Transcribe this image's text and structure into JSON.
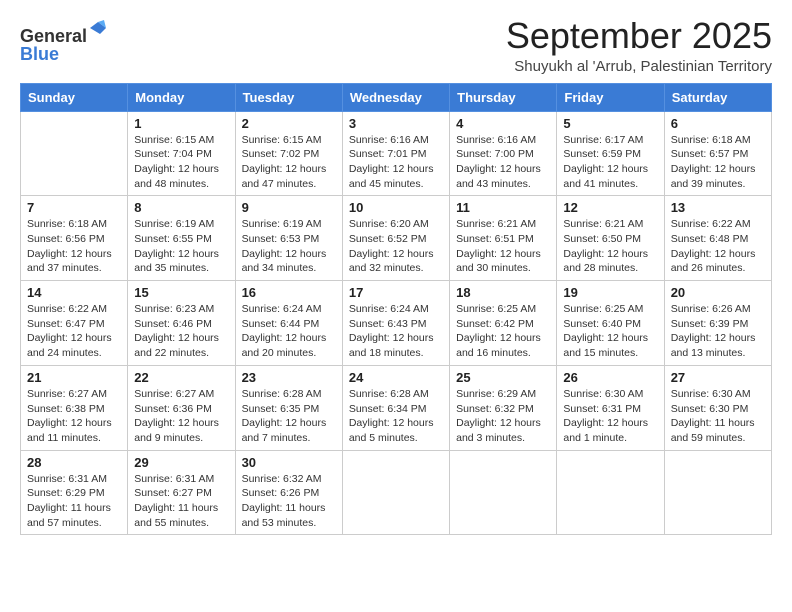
{
  "logo": {
    "general": "General",
    "blue": "Blue"
  },
  "title": "September 2025",
  "subtitle": "Shuyukh al 'Arrub, Palestinian Territory",
  "days_of_week": [
    "Sunday",
    "Monday",
    "Tuesday",
    "Wednesday",
    "Thursday",
    "Friday",
    "Saturday"
  ],
  "weeks": [
    [
      {
        "day": "",
        "info": ""
      },
      {
        "day": "1",
        "info": "Sunrise: 6:15 AM\nSunset: 7:04 PM\nDaylight: 12 hours and 48 minutes."
      },
      {
        "day": "2",
        "info": "Sunrise: 6:15 AM\nSunset: 7:02 PM\nDaylight: 12 hours and 47 minutes."
      },
      {
        "day": "3",
        "info": "Sunrise: 6:16 AM\nSunset: 7:01 PM\nDaylight: 12 hours and 45 minutes."
      },
      {
        "day": "4",
        "info": "Sunrise: 6:16 AM\nSunset: 7:00 PM\nDaylight: 12 hours and 43 minutes."
      },
      {
        "day": "5",
        "info": "Sunrise: 6:17 AM\nSunset: 6:59 PM\nDaylight: 12 hours and 41 minutes."
      },
      {
        "day": "6",
        "info": "Sunrise: 6:18 AM\nSunset: 6:57 PM\nDaylight: 12 hours and 39 minutes."
      }
    ],
    [
      {
        "day": "7",
        "info": "Sunrise: 6:18 AM\nSunset: 6:56 PM\nDaylight: 12 hours and 37 minutes."
      },
      {
        "day": "8",
        "info": "Sunrise: 6:19 AM\nSunset: 6:55 PM\nDaylight: 12 hours and 35 minutes."
      },
      {
        "day": "9",
        "info": "Sunrise: 6:19 AM\nSunset: 6:53 PM\nDaylight: 12 hours and 34 minutes."
      },
      {
        "day": "10",
        "info": "Sunrise: 6:20 AM\nSunset: 6:52 PM\nDaylight: 12 hours and 32 minutes."
      },
      {
        "day": "11",
        "info": "Sunrise: 6:21 AM\nSunset: 6:51 PM\nDaylight: 12 hours and 30 minutes."
      },
      {
        "day": "12",
        "info": "Sunrise: 6:21 AM\nSunset: 6:50 PM\nDaylight: 12 hours and 28 minutes."
      },
      {
        "day": "13",
        "info": "Sunrise: 6:22 AM\nSunset: 6:48 PM\nDaylight: 12 hours and 26 minutes."
      }
    ],
    [
      {
        "day": "14",
        "info": "Sunrise: 6:22 AM\nSunset: 6:47 PM\nDaylight: 12 hours and 24 minutes."
      },
      {
        "day": "15",
        "info": "Sunrise: 6:23 AM\nSunset: 6:46 PM\nDaylight: 12 hours and 22 minutes."
      },
      {
        "day": "16",
        "info": "Sunrise: 6:24 AM\nSunset: 6:44 PM\nDaylight: 12 hours and 20 minutes."
      },
      {
        "day": "17",
        "info": "Sunrise: 6:24 AM\nSunset: 6:43 PM\nDaylight: 12 hours and 18 minutes."
      },
      {
        "day": "18",
        "info": "Sunrise: 6:25 AM\nSunset: 6:42 PM\nDaylight: 12 hours and 16 minutes."
      },
      {
        "day": "19",
        "info": "Sunrise: 6:25 AM\nSunset: 6:40 PM\nDaylight: 12 hours and 15 minutes."
      },
      {
        "day": "20",
        "info": "Sunrise: 6:26 AM\nSunset: 6:39 PM\nDaylight: 12 hours and 13 minutes."
      }
    ],
    [
      {
        "day": "21",
        "info": "Sunrise: 6:27 AM\nSunset: 6:38 PM\nDaylight: 12 hours and 11 minutes."
      },
      {
        "day": "22",
        "info": "Sunrise: 6:27 AM\nSunset: 6:36 PM\nDaylight: 12 hours and 9 minutes."
      },
      {
        "day": "23",
        "info": "Sunrise: 6:28 AM\nSunset: 6:35 PM\nDaylight: 12 hours and 7 minutes."
      },
      {
        "day": "24",
        "info": "Sunrise: 6:28 AM\nSunset: 6:34 PM\nDaylight: 12 hours and 5 minutes."
      },
      {
        "day": "25",
        "info": "Sunrise: 6:29 AM\nSunset: 6:32 PM\nDaylight: 12 hours and 3 minutes."
      },
      {
        "day": "26",
        "info": "Sunrise: 6:30 AM\nSunset: 6:31 PM\nDaylight: 12 hours and 1 minute."
      },
      {
        "day": "27",
        "info": "Sunrise: 6:30 AM\nSunset: 6:30 PM\nDaylight: 11 hours and 59 minutes."
      }
    ],
    [
      {
        "day": "28",
        "info": "Sunrise: 6:31 AM\nSunset: 6:29 PM\nDaylight: 11 hours and 57 minutes."
      },
      {
        "day": "29",
        "info": "Sunrise: 6:31 AM\nSunset: 6:27 PM\nDaylight: 11 hours and 55 minutes."
      },
      {
        "day": "30",
        "info": "Sunrise: 6:32 AM\nSunset: 6:26 PM\nDaylight: 11 hours and 53 minutes."
      },
      {
        "day": "",
        "info": ""
      },
      {
        "day": "",
        "info": ""
      },
      {
        "day": "",
        "info": ""
      },
      {
        "day": "",
        "info": ""
      }
    ]
  ]
}
